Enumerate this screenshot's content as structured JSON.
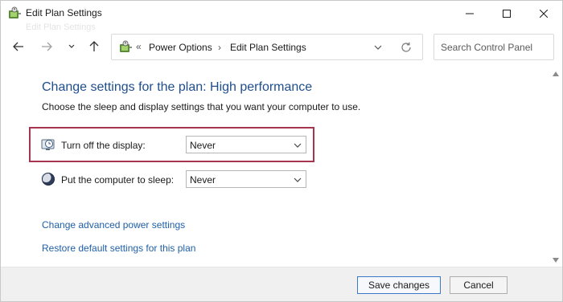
{
  "window": {
    "title": "Edit Plan Settings",
    "ghost_title": "Edit Plan Settings"
  },
  "address_bar": {
    "chevron": "«",
    "crumbs": [
      "Power Options",
      "Edit Plan Settings"
    ],
    "separator": "›"
  },
  "search": {
    "placeholder": "Search Control Panel"
  },
  "main": {
    "heading": "Change settings for the plan: High performance",
    "subtext": "Choose the sleep and display settings that you want your computer to use.",
    "settings": [
      {
        "label": "Turn off the display:",
        "value": "Never",
        "icon": "display-clock-icon",
        "highlighted": true
      },
      {
        "label": "Put the computer to sleep:",
        "value": "Never",
        "icon": "moon-sleep-icon",
        "highlighted": false
      }
    ],
    "links": [
      "Change advanced power settings",
      "Restore default settings for this plan"
    ]
  },
  "footer": {
    "save_label": "Save changes",
    "cancel_label": "Cancel"
  },
  "colors": {
    "heading": "#1f4e8c",
    "link": "#1f5fa8",
    "highlight_border": "#a7344e",
    "footer_bg": "#f0f0f0"
  }
}
